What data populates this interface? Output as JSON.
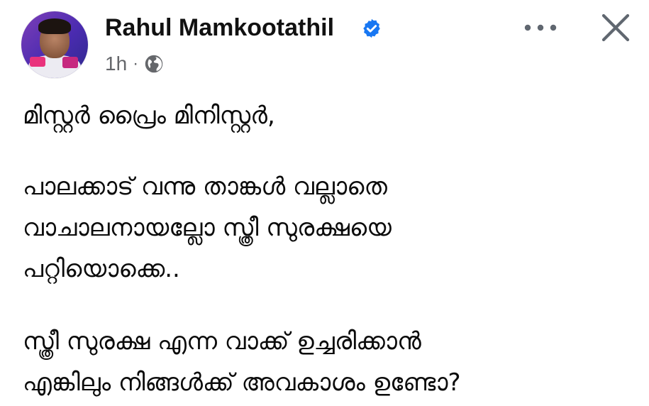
{
  "author": {
    "name": "Rahul Mamkootathil",
    "verified": true,
    "verified_icon": "verified-badge-icon",
    "verified_color": "#1877f2"
  },
  "meta": {
    "time": "1h",
    "separator": "·",
    "audience_icon": "globe-icon"
  },
  "actions": {
    "more_icon": "more-dots-icon",
    "close_icon": "close-icon"
  },
  "post": {
    "lines": [
      "മിസ്റ്റർ പ്രൈം മിനിസ്റ്റർ,",
      "പാലക്കാട് വന്നു താങ്കൾ വല്ലാതെ",
      "വാചാലനായല്ലോ സ്ത്രീ സുരക്ഷയെ",
      "പറ്റിയൊക്കെ..",
      "സ്ത്രീ സുരക്ഷ എന്ന വാക്ക് ഉച്ചരിക്കാൻ",
      "എങ്കിലും നിങ്ങൾക്ക് അവകാശം ഉണ്ടോ?"
    ]
  },
  "colors": {
    "text": "#0b0b0b",
    "meta": "#65676b",
    "icon": "#606770",
    "background": "#ffffff"
  }
}
